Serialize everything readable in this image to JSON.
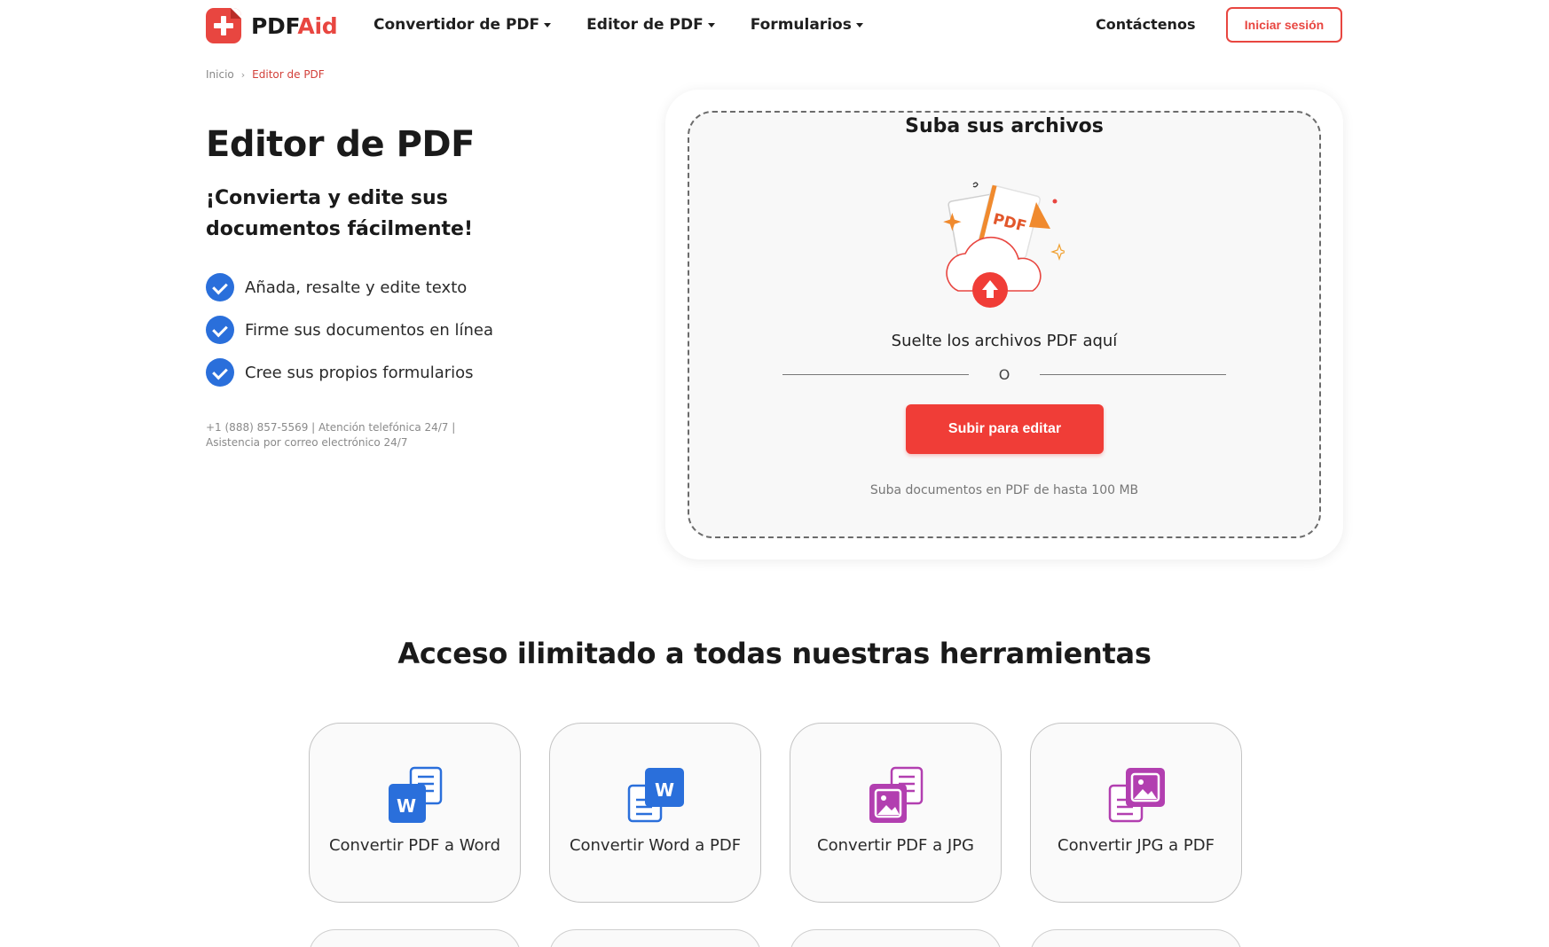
{
  "header": {
    "logo": {
      "part1": "PDF",
      "part2": "Aid",
      "icon": "plus-icon"
    },
    "nav": [
      {
        "label": "Convertidor de PDF"
      },
      {
        "label": "Editor de PDF"
      },
      {
        "label": "Formularios"
      }
    ],
    "contact_label": "Contáctenos",
    "login_label": "Iniciar sesión"
  },
  "breadcrumb": {
    "home": "Inicio",
    "current": "Editor de PDF"
  },
  "hero": {
    "title": "Editor de PDF",
    "subtitle": "¡Convierta y edite sus documentos fácilmente!",
    "features": [
      "Añada, resalte y edite texto",
      "Firme sus documentos en línea",
      "Cree sus propios formularios"
    ],
    "contact_info": "+1 (888) 857-5569 | Atención telefónica 24/7 | Asistencia por correo electrónico 24/7"
  },
  "upload": {
    "title": "Suba sus archivos",
    "illustration_label": "PDF",
    "drop_text": "Suelte los archivos PDF aquí",
    "or_text": "O",
    "button_label": "Subir para editar",
    "note": "Suba documentos en PDF de hasta 100 MB"
  },
  "tools": {
    "title": "Acceso ilimitado a todas nuestras herramientas",
    "items": [
      {
        "label": "Convertir PDF a Word",
        "icon": "pdf-to-word-icon"
      },
      {
        "label": "Convertir Word a PDF",
        "icon": "word-to-pdf-icon"
      },
      {
        "label": "Convertir PDF a JPG",
        "icon": "pdf-to-jpg-icon"
      },
      {
        "label": "Convertir JPG a PDF",
        "icon": "jpg-to-pdf-icon"
      }
    ],
    "icon_letter": "W"
  },
  "colors": {
    "brand_red": "#e84640",
    "button_red": "#f03d37",
    "check_blue": "#2a6fdb",
    "word_blue": "#2a6fdb",
    "jpg_purple": "#b23fb0"
  }
}
